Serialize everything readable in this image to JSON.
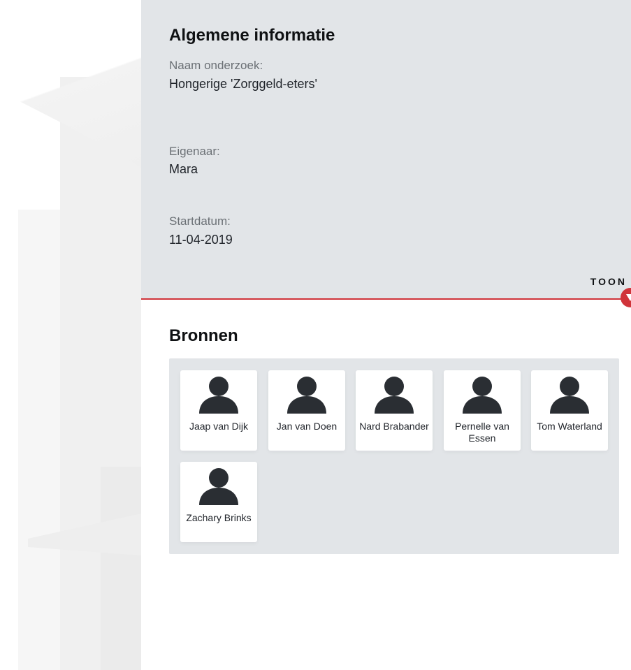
{
  "info": {
    "title": "Algemene informatie",
    "fields": [
      {
        "label": "Naam onderzoek:",
        "value": "Hongerige 'Zorggeld-eters'"
      },
      {
        "label": "Eigenaar:",
        "value": "Mara"
      },
      {
        "label": "Startdatum:",
        "value": "11-04-2019"
      }
    ],
    "toggle_label": "TOON"
  },
  "bronnen": {
    "title": "Bronnen",
    "items": [
      {
        "name": "Jaap van Dijk",
        "icon": "person-icon"
      },
      {
        "name": "Jan van Doen",
        "icon": "person-icon"
      },
      {
        "name": "Nard Brabander",
        "icon": "person-icon"
      },
      {
        "name": "Pernelle van Essen",
        "icon": "person-icon"
      },
      {
        "name": "Tom Waterland",
        "icon": "person-icon"
      },
      {
        "name": "Zachary Brinks",
        "icon": "person-icon"
      }
    ]
  },
  "colors": {
    "accent": "#d0343a",
    "panel": "#e2e5e8",
    "avatar": "#2a2e33"
  }
}
